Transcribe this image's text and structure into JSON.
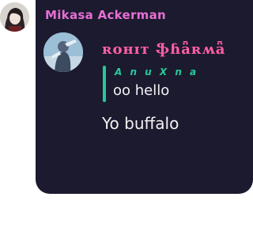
{
  "message": {
    "sender": "Mikasa Ackerman",
    "reply": {
      "author": "ʀᴏʜɪᴛ ֆɦǟʀʍǟ",
      "tag": "A n u X n a",
      "text": "oo hello"
    },
    "body": "Yo buffalo"
  },
  "colors": {
    "bubble": "#1c1a2f",
    "sender": "#e66fd4",
    "reply_author": "#ff5fa5",
    "reply_accent": "#23c99a"
  }
}
